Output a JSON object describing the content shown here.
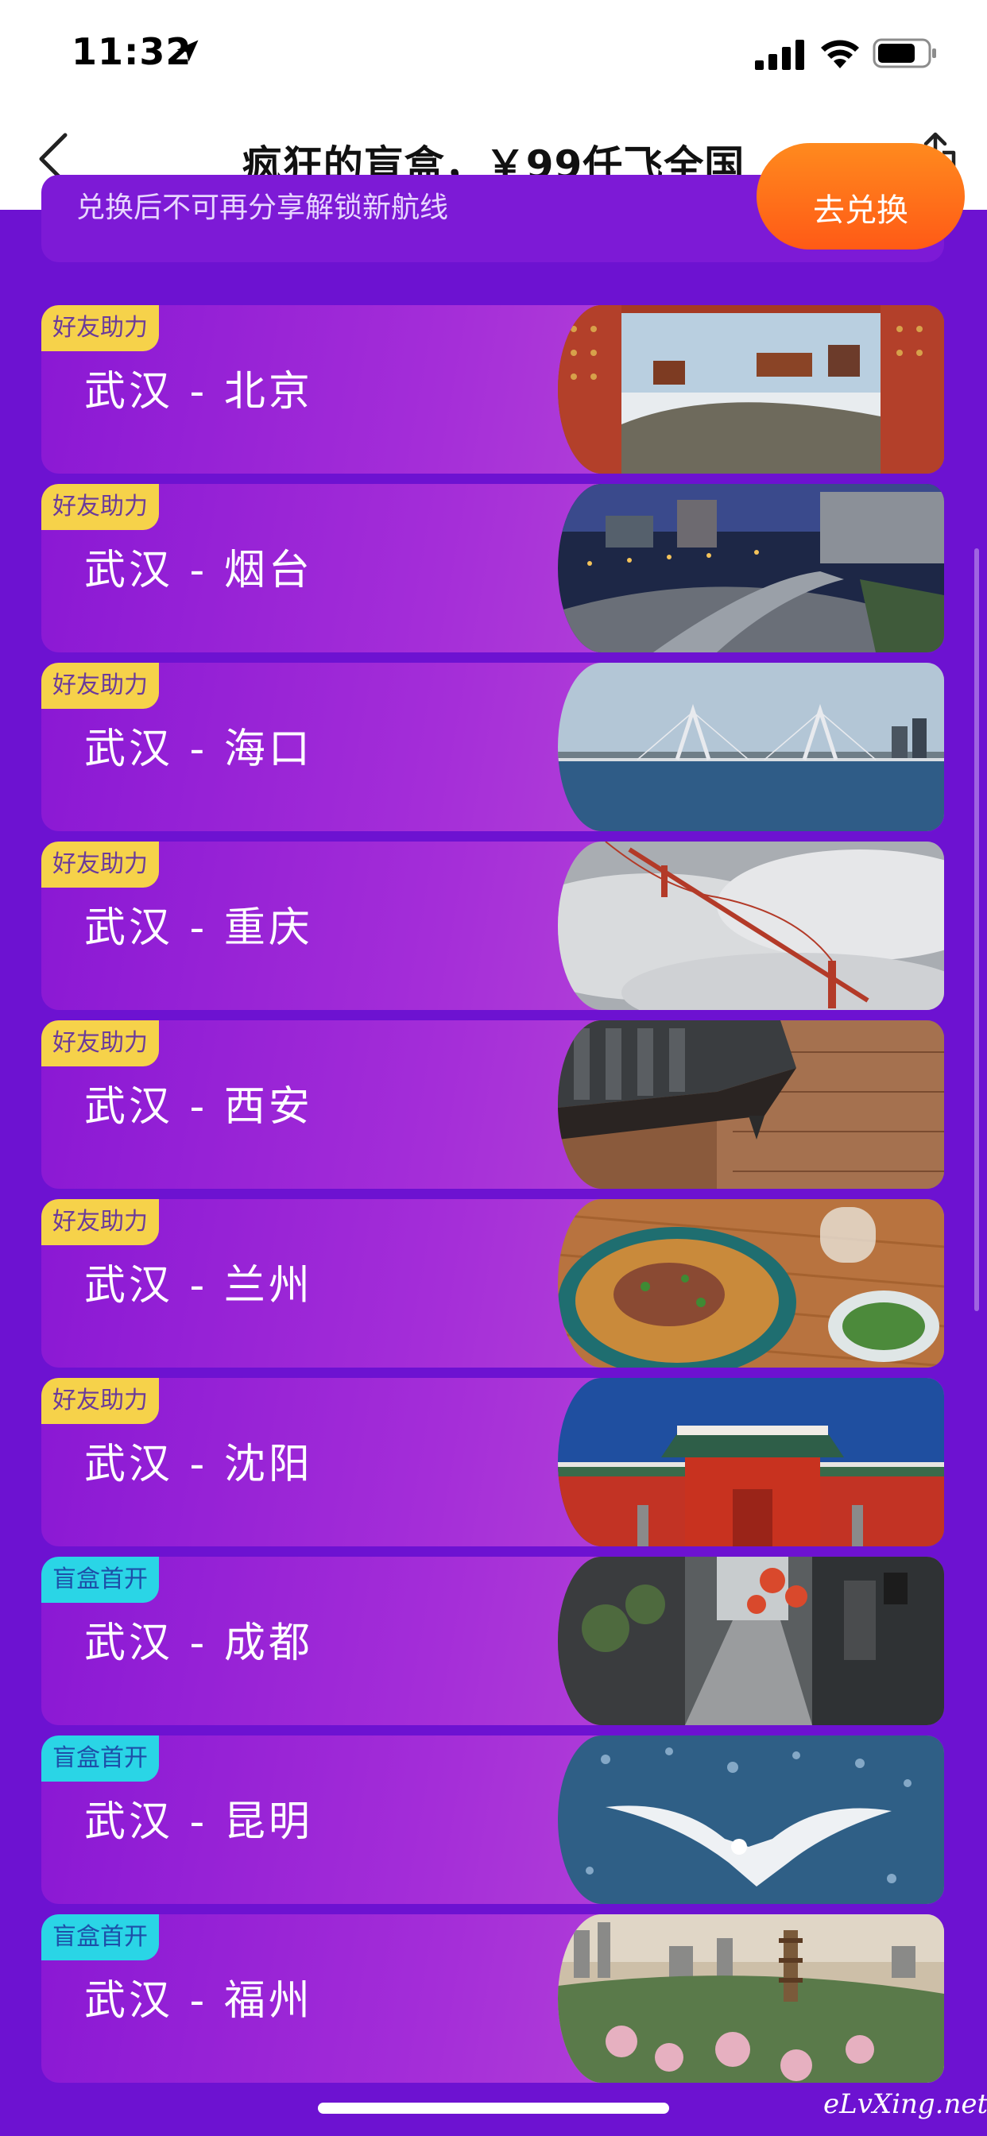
{
  "status_bar": {
    "time": "11:32"
  },
  "nav": {
    "title": "疯狂的盲盒，￥99任飞全国"
  },
  "banner": {
    "text": "兑换后不可再分享解锁新航线",
    "button_label": "去兑换"
  },
  "routes": [
    {
      "tag": "好友助力",
      "tag_type": "helper",
      "route": "武汉 - 北京",
      "photo": "forbidden-city-gate-photo"
    },
    {
      "tag": "好友助力",
      "tag_type": "helper",
      "route": "武汉 - 烟台",
      "photo": "city-night-highway-photo"
    },
    {
      "tag": "好友助力",
      "tag_type": "helper",
      "route": "武汉 - 海口",
      "photo": "cable-bridge-sea-photo"
    },
    {
      "tag": "好友助力",
      "tag_type": "helper",
      "route": "武汉 - 重庆",
      "photo": "bridge-in-clouds-photo"
    },
    {
      "tag": "好友助力",
      "tag_type": "helper",
      "route": "武汉 - 西安",
      "photo": "ancient-roof-eave-photo"
    },
    {
      "tag": "好友助力",
      "tag_type": "helper",
      "route": "武汉 - 兰州",
      "photo": "beef-noodle-bowl-photo"
    },
    {
      "tag": "好友助力",
      "tag_type": "helper",
      "route": "武汉 - 沈阳",
      "photo": "red-palace-wall-photo"
    },
    {
      "tag": "盲盒首开",
      "tag_type": "blindbox",
      "route": "武汉 - 成都",
      "photo": "old-street-lanterns-photo"
    },
    {
      "tag": "盲盒首开",
      "tag_type": "blindbox",
      "route": "武汉 - 昆明",
      "photo": "seagull-lake-photo"
    },
    {
      "tag": "盲盒首开",
      "tag_type": "blindbox",
      "route": "武汉 - 福州",
      "photo": "pagoda-city-aerial-photo"
    }
  ],
  "watermark": "eLvXing.net",
  "colors": {
    "background": "#6d12d1",
    "card_start": "#8a18d4",
    "card_end": "#c45ad9",
    "tag_helper": "#f6d24a",
    "tag_blindbox": "#2ad5e6",
    "banner_button": "#ff6a18"
  }
}
